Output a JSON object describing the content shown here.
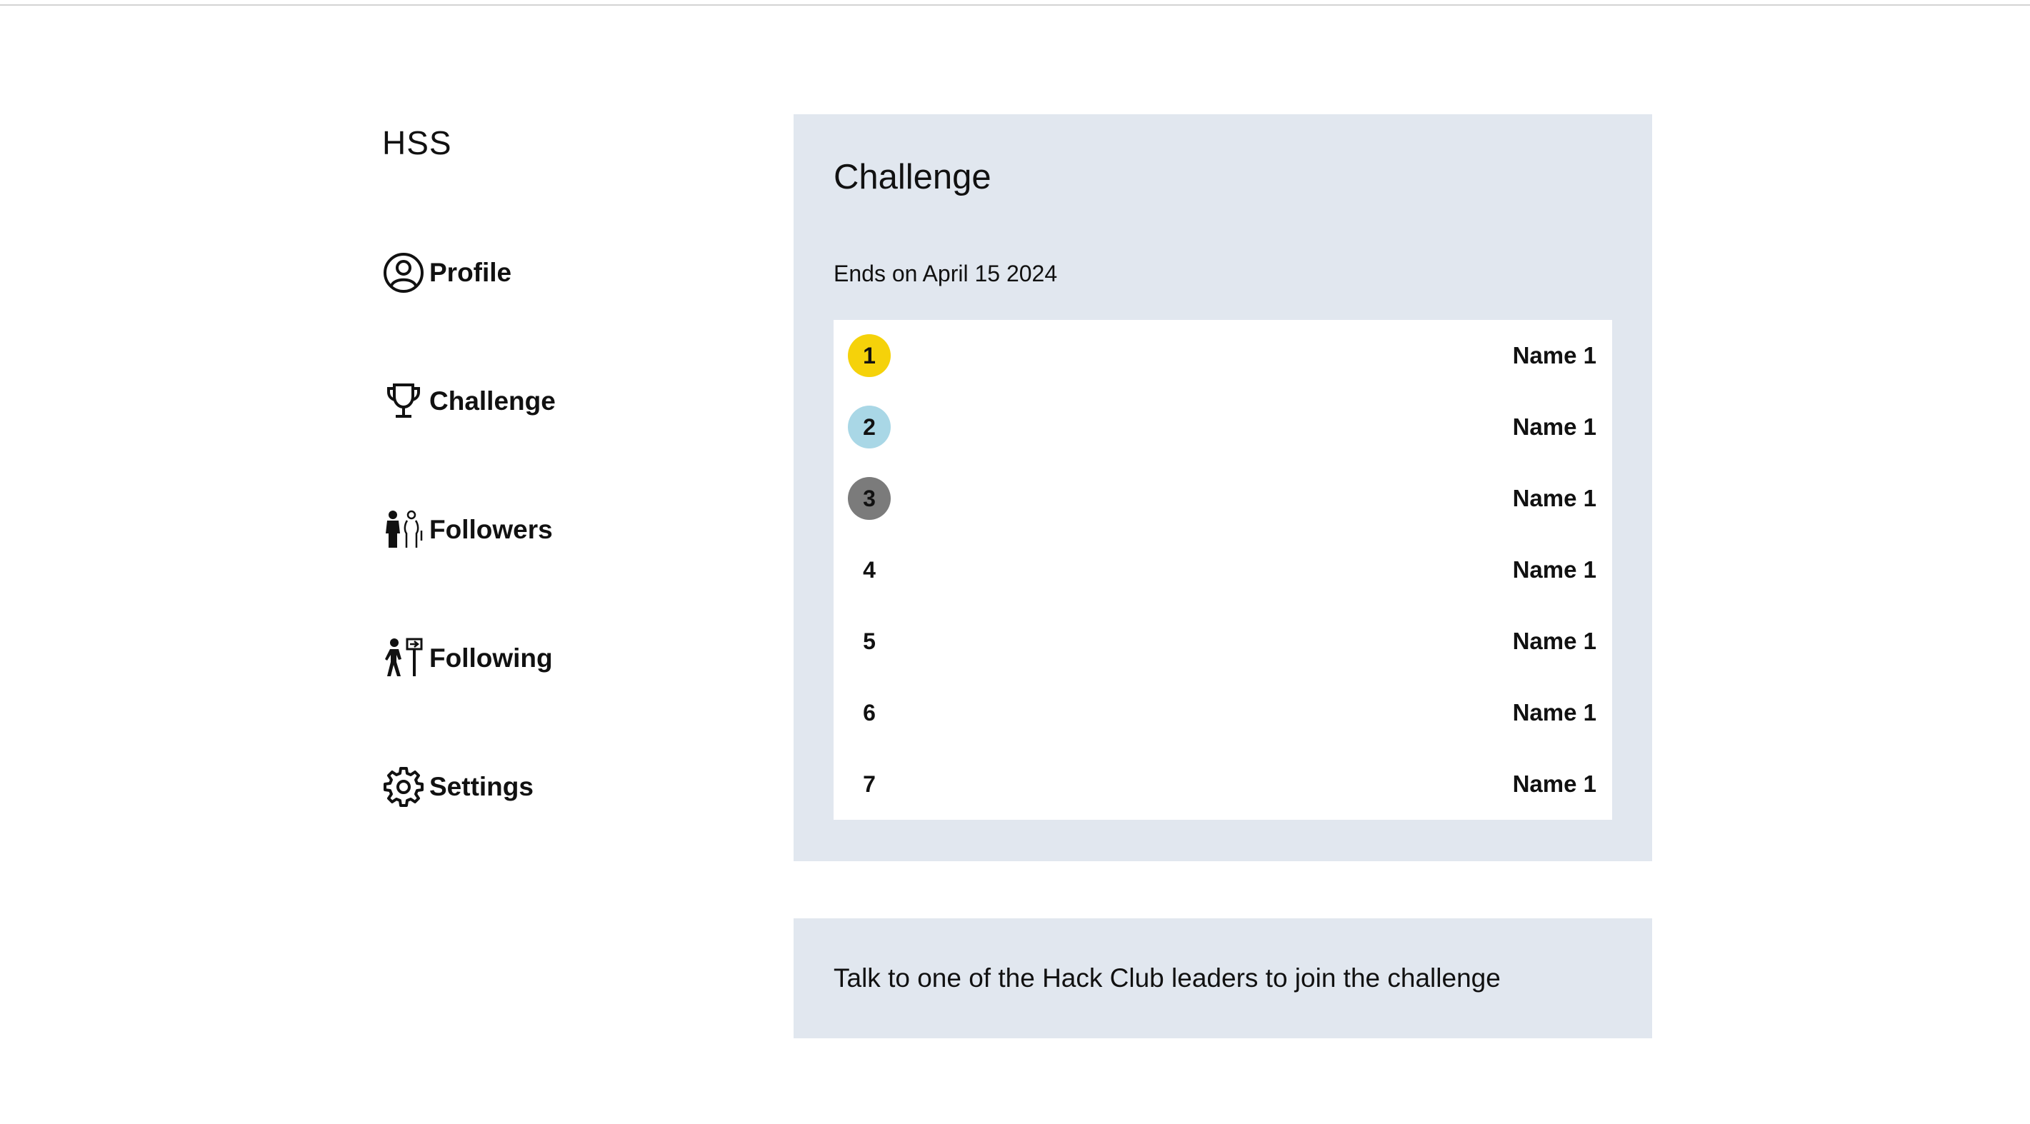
{
  "app": {
    "brand": "HSS"
  },
  "sidebar": {
    "items": [
      {
        "label": "Profile",
        "icon": "user-circle-icon"
      },
      {
        "label": "Challenge",
        "icon": "trophy-icon"
      },
      {
        "label": "Followers",
        "icon": "followers-icon"
      },
      {
        "label": "Following",
        "icon": "following-icon"
      },
      {
        "label": "Settings",
        "icon": "gear-icon"
      }
    ]
  },
  "challenge": {
    "title": "Challenge",
    "ends": "Ends on April 15 2024",
    "leaderboard": [
      {
        "rank": "1",
        "name": "Name 1",
        "badge_color": "#f5d20a"
      },
      {
        "rank": "2",
        "name": "Name 1",
        "badge_color": "#a9d7e6"
      },
      {
        "rank": "3",
        "name": "Name 1",
        "badge_color": "#7b7b7b"
      },
      {
        "rank": "4",
        "name": "Name 1",
        "badge_color": ""
      },
      {
        "rank": "5",
        "name": "Name 1",
        "badge_color": ""
      },
      {
        "rank": "6",
        "name": "Name 1",
        "badge_color": ""
      },
      {
        "rank": "7",
        "name": "Name 1",
        "badge_color": ""
      }
    ]
  },
  "info": {
    "text": "Talk to one of the Hack Club leaders to join the challenge"
  },
  "colors": {
    "panel_bg": "#e1e7ef",
    "gold": "#f5d20a",
    "silver": "#a9d7e6",
    "bronze": "#7b7b7b"
  }
}
